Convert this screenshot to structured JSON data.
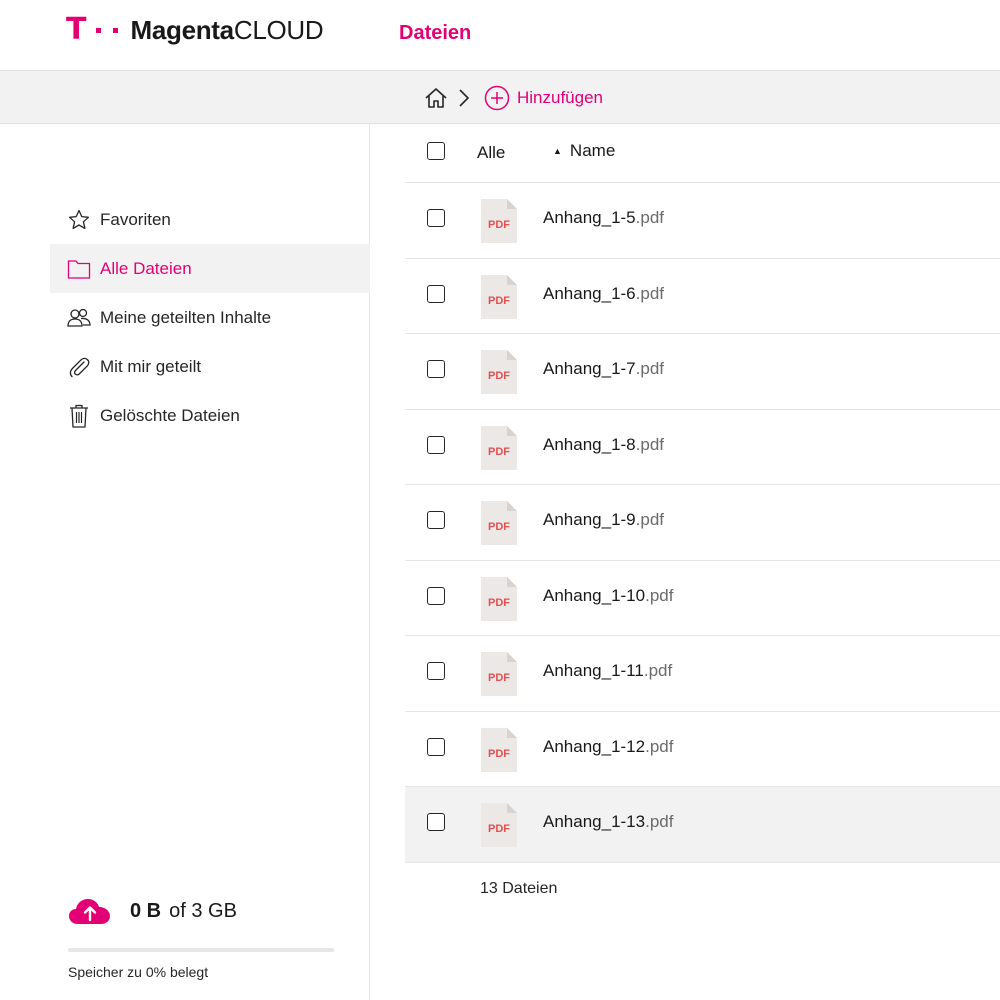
{
  "header": {
    "logo_mark": "T",
    "brand_bold": "Magenta",
    "brand_regular": "CLOUD",
    "section_title": "Dateien"
  },
  "breadcrumb": {
    "add_label": "Hinzufügen"
  },
  "sidebar": {
    "items": [
      {
        "label": "Favoriten",
        "icon": "star-icon"
      },
      {
        "label": "Alle Dateien",
        "icon": "folder-icon",
        "active": true
      },
      {
        "label": "Meine geteilten Inhalte",
        "icon": "shared-users-icon"
      },
      {
        "label": "Mit mir geteilt",
        "icon": "paperclip-icon"
      },
      {
        "label": "Gelöschte Dateien",
        "icon": "trash-icon"
      }
    ]
  },
  "storage": {
    "used": "0 B",
    "of_total": "of 3 GB",
    "caption": "Speicher zu 0% belegt",
    "fraction_used": 0
  },
  "list": {
    "select_all_label": "Alle",
    "sort_label": "Name",
    "files": [
      {
        "base": "Anhang_1-5",
        "ext": ".pdf",
        "type_label": "PDF"
      },
      {
        "base": "Anhang_1-6",
        "ext": ".pdf",
        "type_label": "PDF"
      },
      {
        "base": "Anhang_1-7",
        "ext": ".pdf",
        "type_label": "PDF"
      },
      {
        "base": "Anhang_1-8",
        "ext": ".pdf",
        "type_label": "PDF"
      },
      {
        "base": "Anhang_1-9",
        "ext": ".pdf",
        "type_label": "PDF"
      },
      {
        "base": "Anhang_1-10",
        "ext": ".pdf",
        "type_label": "PDF"
      },
      {
        "base": "Anhang_1-11",
        "ext": ".pdf",
        "type_label": "PDF"
      },
      {
        "base": "Anhang_1-12",
        "ext": ".pdf",
        "type_label": "PDF"
      },
      {
        "base": "Anhang_1-13",
        "ext": ".pdf",
        "type_label": "PDF"
      }
    ],
    "count_label": "13 Dateien"
  },
  "colors": {
    "brand": "#e20074",
    "pdf_red": "#e05151"
  }
}
